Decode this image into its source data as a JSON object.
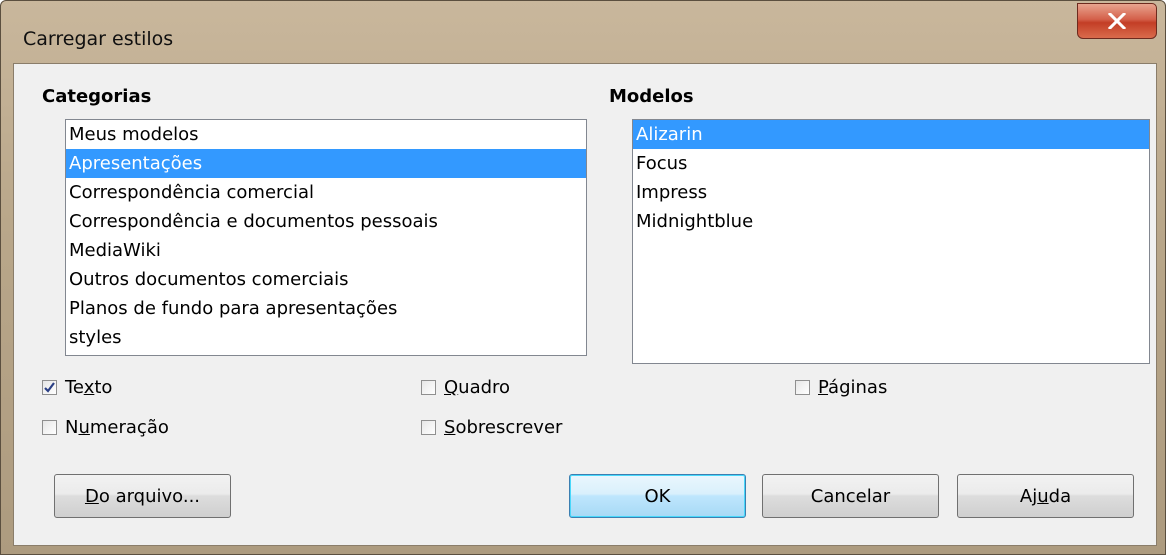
{
  "window": {
    "title": "Carregar estilos",
    "close_symbol": "x"
  },
  "categories": {
    "heading": "Categorias",
    "items": [
      "Meus modelos",
      "Apresentações",
      "Correspondência comercial",
      "Correspondência e documentos pessoais",
      "MediaWiki",
      "Outros documentos comerciais",
      "Planos de fundo para apresentações",
      "styles"
    ],
    "selected": "Apresentações"
  },
  "templates": {
    "heading": "Modelos",
    "items": [
      "Alizarin",
      "Focus",
      "Impress",
      "Midnightblue"
    ],
    "selected": "Alizarin"
  },
  "options": {
    "text": {
      "pre": "Te",
      "key": "x",
      "post": "to",
      "checked": true
    },
    "frame": {
      "pre": "",
      "key": "Q",
      "post": "uadro",
      "checked": false
    },
    "pages": {
      "pre": "",
      "key": "P",
      "post": "áginas",
      "checked": false
    },
    "numbering": {
      "pre": "N",
      "key": "u",
      "post": "meração",
      "checked": false
    },
    "overwrite": {
      "pre": "",
      "key": "S",
      "post": "obrescrever",
      "checked": false
    }
  },
  "buttons": {
    "from_file": {
      "pre": "",
      "key": "D",
      "post": "o arquivo..."
    },
    "ok": "OK",
    "cancel": "Cancelar",
    "help": {
      "pre": "Aj",
      "key": "u",
      "post": "da"
    }
  },
  "colors": {
    "selection": "#3399ff",
    "close_button": "#c33e26",
    "title_bar": "#b9a78a"
  }
}
